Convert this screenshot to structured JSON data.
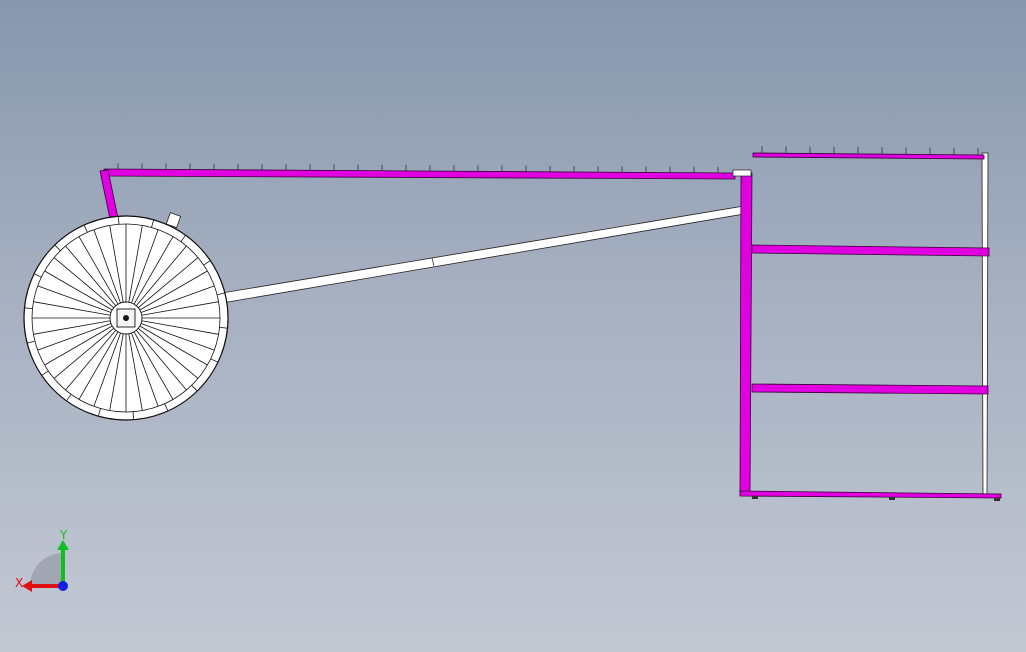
{
  "viewport": {
    "background_top": "#8797ad",
    "background_bottom": "#c3c8d3"
  },
  "model": {
    "highlight_color": "#e000e0",
    "edge_color": "#1a1a1a",
    "face_color": "#ffffff"
  },
  "triad": {
    "x_label": "X",
    "y_label": "Y",
    "x_color": "#e01010",
    "y_color": "#10c020",
    "z_color": "#1020e0"
  }
}
